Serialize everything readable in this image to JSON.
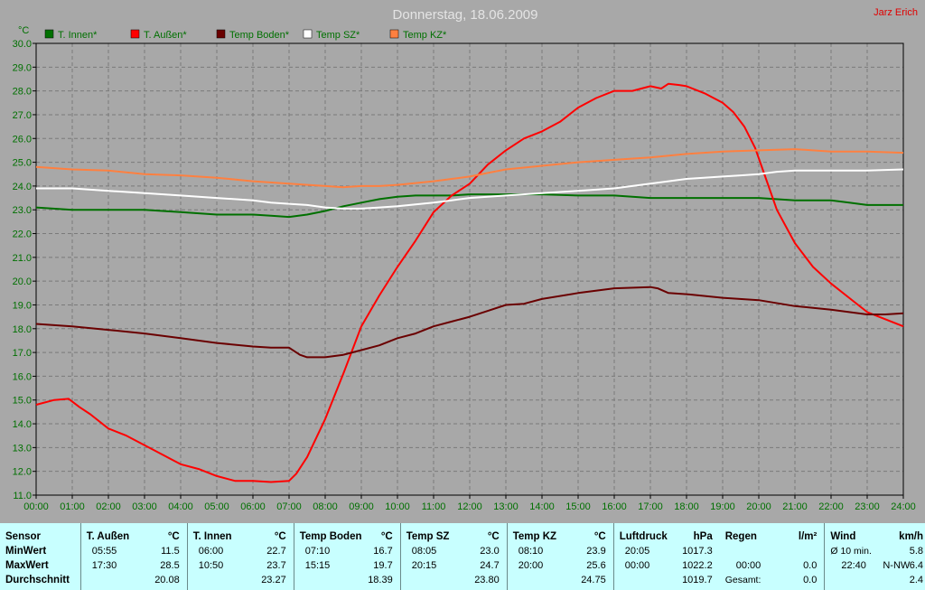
{
  "title": "Donnerstag, 18.06.2009",
  "author": "Jarz Erich",
  "colors": {
    "background": "#a8a8a8",
    "title": "#e4e4e4",
    "axis_text": "#007000",
    "author": "#e00000",
    "grid": "#7a7a7a",
    "stats_bg": "#c8ffff"
  },
  "chart_data": {
    "type": "line",
    "ylabel": "°C",
    "ylim": [
      11.0,
      30.0
    ],
    "xlim": [
      0,
      24
    ],
    "y_ticks": [
      "11.0",
      "12.0",
      "13.0",
      "14.0",
      "15.0",
      "16.0",
      "17.0",
      "18.0",
      "19.0",
      "20.0",
      "21.0",
      "22.0",
      "23.0",
      "24.0",
      "25.0",
      "26.0",
      "27.0",
      "28.0",
      "29.0",
      "30.0"
    ],
    "x_ticks": [
      "00:00",
      "01:00",
      "02:00",
      "03:00",
      "04:00",
      "05:00",
      "06:00",
      "07:00",
      "08:00",
      "09:00",
      "10:00",
      "11:00",
      "12:00",
      "13:00",
      "14:00",
      "15:00",
      "16:00",
      "17:00",
      "18:00",
      "19:00",
      "20:00",
      "21:00",
      "22:00",
      "23:00",
      "24:00"
    ],
    "grid": true,
    "legend_position": "top-left",
    "series": [
      {
        "name": "T. Innen*",
        "color": "#007000",
        "x": [
          0,
          1,
          2,
          3,
          4,
          5,
          6,
          6.5,
          7,
          7.5,
          8,
          8.5,
          9,
          9.5,
          10,
          10.5,
          11,
          11.5,
          12,
          13,
          14,
          15,
          16,
          17,
          18,
          19,
          20,
          21,
          22,
          22.5,
          23,
          24
        ],
        "y": [
          23.1,
          23.0,
          23.0,
          23.0,
          22.9,
          22.8,
          22.8,
          22.75,
          22.7,
          22.8,
          22.95,
          23.15,
          23.3,
          23.45,
          23.55,
          23.6,
          23.6,
          23.6,
          23.65,
          23.65,
          23.65,
          23.6,
          23.6,
          23.5,
          23.5,
          23.5,
          23.5,
          23.4,
          23.4,
          23.3,
          23.2,
          23.2
        ]
      },
      {
        "name": "T. Außen*",
        "color": "#ff0000",
        "x": [
          0,
          0.5,
          0.9,
          1.2,
          1.5,
          2,
          2.5,
          3,
          3.5,
          4,
          4.5,
          5,
          5.5,
          6,
          6.5,
          7,
          7.2,
          7.5,
          8,
          8.5,
          9,
          9.5,
          10,
          10.5,
          11,
          11.5,
          12,
          12.5,
          13,
          13.5,
          14,
          14.5,
          15,
          15.5,
          16,
          16.5,
          17,
          17.3,
          17.5,
          17.8,
          18,
          18.5,
          19,
          19.3,
          19.6,
          19.9,
          20.2,
          20.5,
          21,
          21.5,
          22,
          22.5,
          23,
          23.5,
          24
        ],
        "y": [
          14.8,
          15.0,
          15.05,
          14.7,
          14.4,
          13.8,
          13.5,
          13.1,
          12.7,
          12.3,
          12.1,
          11.8,
          11.6,
          11.6,
          11.55,
          11.6,
          11.9,
          12.6,
          14.2,
          16.1,
          18.1,
          19.4,
          20.6,
          21.7,
          22.9,
          23.6,
          24.1,
          24.9,
          25.5,
          26.0,
          26.3,
          26.7,
          27.3,
          27.7,
          28.0,
          28.0,
          28.2,
          28.1,
          28.3,
          28.25,
          28.2,
          27.9,
          27.5,
          27.1,
          26.5,
          25.6,
          24.3,
          23.0,
          21.6,
          20.6,
          19.9,
          19.3,
          18.7,
          18.4,
          18.1
        ]
      },
      {
        "name": "Temp Boden*",
        "color": "#6a0000",
        "x": [
          0,
          1,
          2,
          3,
          4,
          5,
          6,
          6.5,
          7,
          7.3,
          7.5,
          8,
          8.5,
          9,
          9.5,
          10,
          10.5,
          11,
          11.5,
          12,
          12.5,
          13,
          13.5,
          14,
          15,
          16,
          17,
          17.2,
          17.5,
          18,
          19,
          20,
          21,
          22,
          22.5,
          23,
          23.5,
          24
        ],
        "y": [
          18.2,
          18.1,
          17.95,
          17.8,
          17.6,
          17.4,
          17.25,
          17.2,
          17.2,
          16.9,
          16.8,
          16.8,
          16.9,
          17.1,
          17.3,
          17.6,
          17.8,
          18.1,
          18.3,
          18.5,
          18.75,
          19.0,
          19.05,
          19.25,
          19.5,
          19.7,
          19.75,
          19.7,
          19.5,
          19.45,
          19.3,
          19.2,
          18.95,
          18.8,
          18.7,
          18.6,
          18.6,
          18.65
        ]
      },
      {
        "name": "Temp SZ*",
        "color": "#ffffff",
        "x": [
          0,
          1,
          2,
          3,
          4,
          5,
          6,
          6.5,
          7,
          7.5,
          8,
          8.5,
          9,
          9.5,
          10,
          11,
          11.5,
          12,
          13,
          14,
          15,
          16,
          17,
          18,
          19,
          19.5,
          20,
          20.5,
          21,
          22,
          23,
          24
        ],
        "y": [
          23.9,
          23.9,
          23.8,
          23.7,
          23.6,
          23.5,
          23.4,
          23.3,
          23.25,
          23.2,
          23.1,
          23.05,
          23.05,
          23.1,
          23.15,
          23.3,
          23.4,
          23.5,
          23.6,
          23.7,
          23.8,
          23.9,
          24.1,
          24.3,
          24.4,
          24.45,
          24.5,
          24.6,
          24.65,
          24.65,
          24.65,
          24.7
        ]
      },
      {
        "name": "Temp KZ*",
        "color": "#ff8040",
        "x": [
          0,
          1,
          2,
          3,
          4,
          5,
          6,
          7,
          8,
          8.5,
          9,
          9.5,
          10,
          11,
          11.5,
          12,
          12.5,
          13,
          14,
          15,
          16,
          17,
          18,
          19,
          20,
          21,
          22,
          23,
          24
        ],
        "y": [
          24.8,
          24.7,
          24.65,
          24.5,
          24.45,
          24.35,
          24.2,
          24.1,
          24.0,
          23.95,
          24.0,
          24.0,
          24.05,
          24.2,
          24.3,
          24.4,
          24.55,
          24.7,
          24.85,
          25.0,
          25.1,
          25.2,
          25.35,
          25.45,
          25.5,
          25.55,
          25.45,
          25.45,
          25.4
        ]
      }
    ]
  },
  "stats": {
    "row_labels": {
      "header": "Sensor",
      "min": "MinWert",
      "max": "MaxWert",
      "avg": "Durchschnitt"
    },
    "columns": [
      {
        "name": "T. Außen",
        "unit": "°C",
        "min_time": "05:55",
        "min_val": "11.5",
        "max_time": "17:30",
        "max_val": "28.5",
        "avg": "20.08"
      },
      {
        "name": "T. Innen",
        "unit": "°C",
        "min_time": "06:00",
        "min_val": "22.7",
        "max_time": "10:50",
        "max_val": "23.7",
        "avg": "23.27"
      },
      {
        "name": "Temp Boden",
        "unit": "°C",
        "min_time": "07:10",
        "min_val": "16.7",
        "max_time": "15:15",
        "max_val": "19.7",
        "avg": "18.39"
      },
      {
        "name": "Temp SZ",
        "unit": "°C",
        "min_time": "08:05",
        "min_val": "23.0",
        "max_time": "20:15",
        "max_val": "24.7",
        "avg": "23.80"
      },
      {
        "name": "Temp KZ",
        "unit": "°C",
        "min_time": "08:10",
        "min_val": "23.9",
        "max_time": "20:00",
        "max_val": "25.6",
        "avg": "24.75"
      },
      {
        "name": "Luftdruck",
        "unit": "hPa",
        "min_time": "20:05",
        "min_val": "1017.3",
        "max_time": "00:00",
        "max_val": "1022.2",
        "avg": "1019.7"
      }
    ],
    "regen": {
      "name": "Regen",
      "unit": "l/m²",
      "max_time": "00:00",
      "max_val": "0.0",
      "total_label": "Gesamt:",
      "total_val": "0.0"
    },
    "wind": {
      "name": "Wind",
      "unit": "km/h",
      "avg_label": "Ø 10 min.",
      "avg_val": "5.8",
      "max_time": "22:40",
      "dir": "N-NW",
      "max_val": "6.4",
      "day_avg": "2.4"
    }
  }
}
